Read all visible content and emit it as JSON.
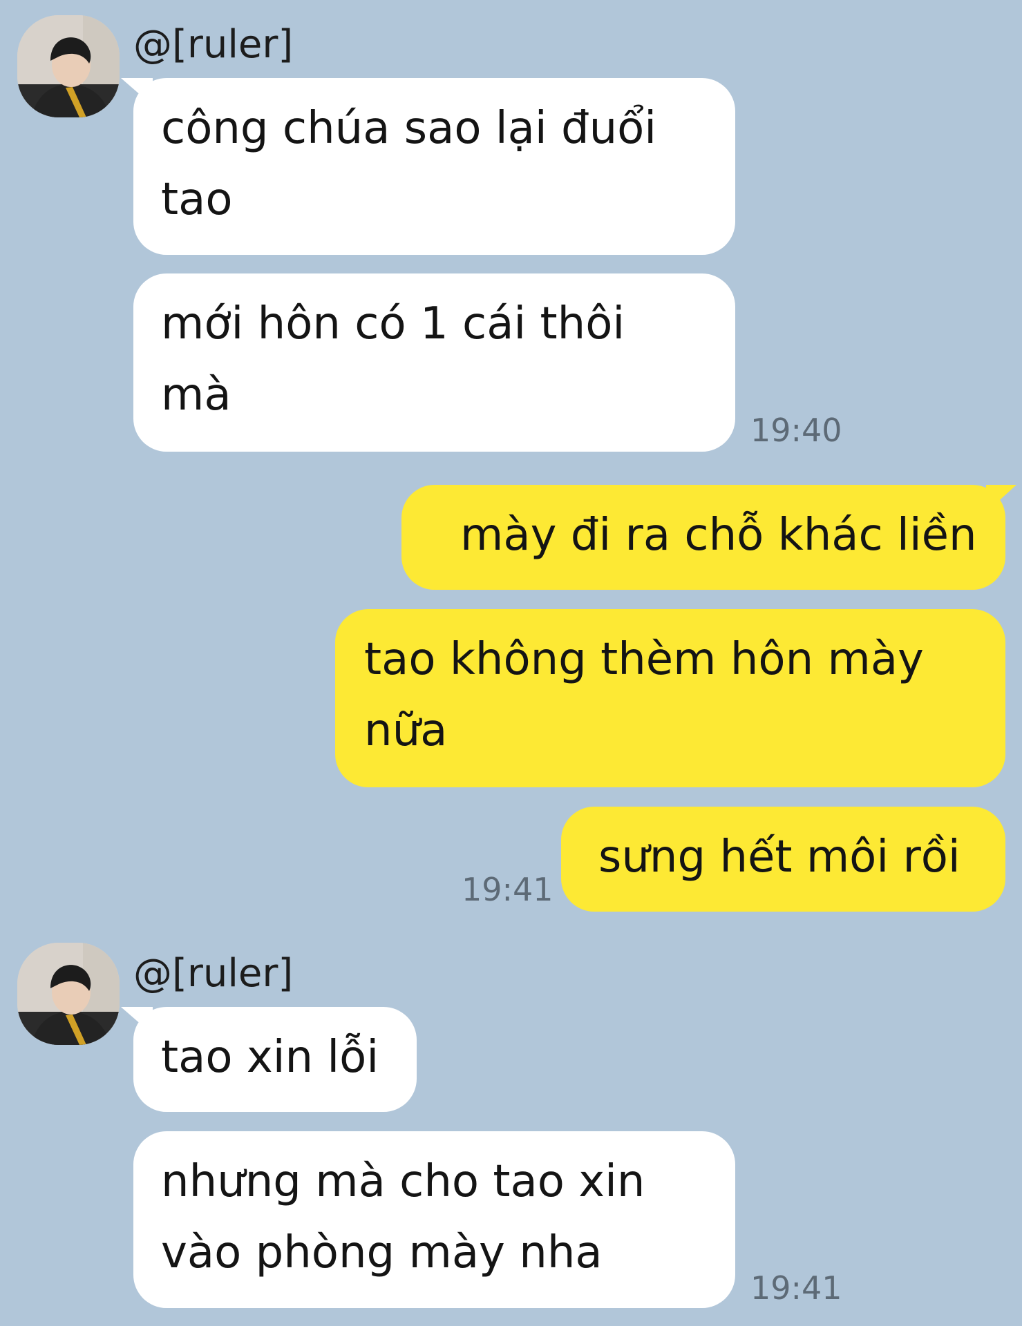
{
  "messages": [
    {
      "sender": "@[ruler]",
      "bubbles": [
        {
          "lines": [
            "công chúa sao lại đuổi",
            "tao"
          ]
        },
        {
          "lines": [
            "mới hôn có 1 cái thôi",
            "mà"
          ]
        }
      ],
      "time": "19:40"
    },
    {
      "bubbles": [
        {
          "lines": [
            "mày đi ra chỗ khác liền"
          ]
        },
        {
          "lines": [
            "tao không thèm hôn mày",
            "nữa"
          ]
        },
        {
          "lines": [
            "sưng hết môi rồi"
          ]
        }
      ],
      "time": "19:41"
    },
    {
      "sender": "@[ruler]",
      "bubbles": [
        {
          "lines": [
            "tao xin lỗi"
          ]
        },
        {
          "lines": [
            "nhưng mà cho tao xin",
            "vào phòng mày nha"
          ]
        }
      ],
      "time": "19:41"
    }
  ],
  "icons": {
    "avatar": "user-avatar-photo"
  }
}
